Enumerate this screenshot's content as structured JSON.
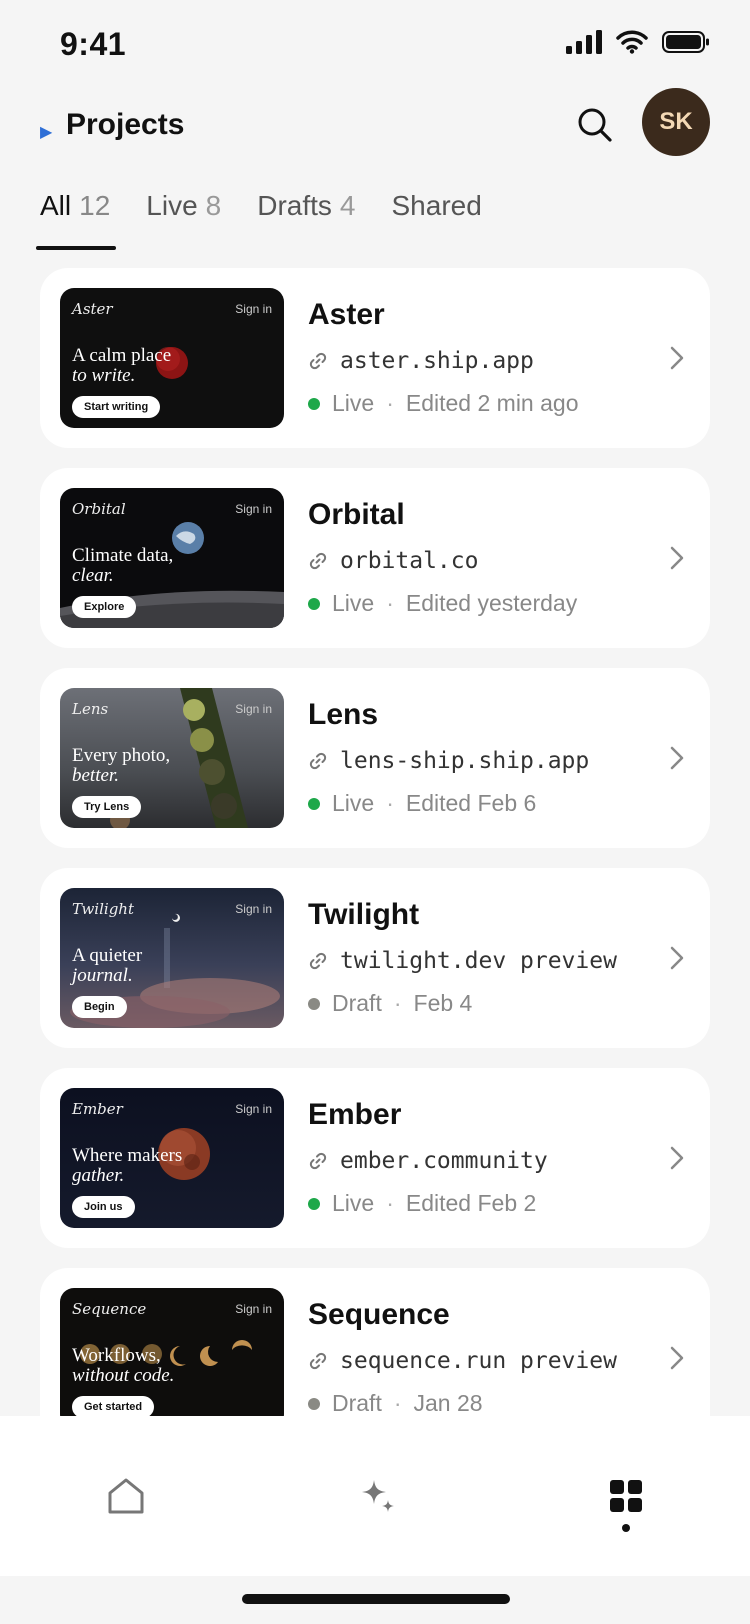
{
  "status_bar": {
    "time": "9:41"
  },
  "header": {
    "title": "Projects",
    "avatar_initials": "SK"
  },
  "tabs": [
    {
      "label": "All",
      "count": "12"
    },
    {
      "label": "Live",
      "count": "8"
    },
    {
      "label": "Drafts",
      "count": "4"
    },
    {
      "label": "Shared",
      "count": ""
    }
  ],
  "projects": [
    {
      "name": "Aster",
      "url": "aster.ship.app",
      "status": "Live",
      "edited": "Edited 2 min ago",
      "thumb": {
        "brand": "Aster",
        "signin": "Sign in",
        "line1": "A calm place",
        "line2": "to write.",
        "cta": "Start writing"
      }
    },
    {
      "name": "Orbital",
      "url": "orbital.co",
      "status": "Live",
      "edited": "Edited yesterday",
      "thumb": {
        "brand": "Orbital",
        "signin": "Sign in",
        "line1": "Climate data,",
        "line2": "clear.",
        "cta": "Explore"
      }
    },
    {
      "name": "Lens",
      "url": "lens-ship.ship.app",
      "status": "Live",
      "edited": "Edited Feb 6",
      "thumb": {
        "brand": "Lens",
        "signin": "Sign in",
        "line1": "Every photo,",
        "line2": "better.",
        "cta": "Try Lens"
      }
    },
    {
      "name": "Twilight",
      "url": "twilight.dev preview",
      "status": "Draft",
      "edited": "Feb 4",
      "thumb": {
        "brand": "Twilight",
        "signin": "Sign in",
        "line1": "A quieter",
        "line2": "journal.",
        "cta": "Begin"
      }
    },
    {
      "name": "Ember",
      "url": "ember.community",
      "status": "Live",
      "edited": "Edited Feb 2",
      "thumb": {
        "brand": "Ember",
        "signin": "Sign in",
        "line1": "Where makers",
        "line2": "gather.",
        "cta": "Join us"
      }
    },
    {
      "name": "Sequence",
      "url": "sequence.run preview",
      "status": "Draft",
      "edited": "Jan 28",
      "thumb": {
        "brand": "Sequence",
        "signin": "Sign in",
        "line1": "Workflows,",
        "line2": "without code.",
        "cta": "Get started"
      }
    }
  ],
  "colors": {
    "live": "#1ea84a",
    "draft": "#8a8a84",
    "accent": "#2f6fd6",
    "avatar_bg": "#3b2a1c"
  },
  "bottom_nav": {
    "items": [
      "home-icon",
      "sparkle-icon",
      "grid-icon"
    ],
    "active": "grid-icon"
  }
}
